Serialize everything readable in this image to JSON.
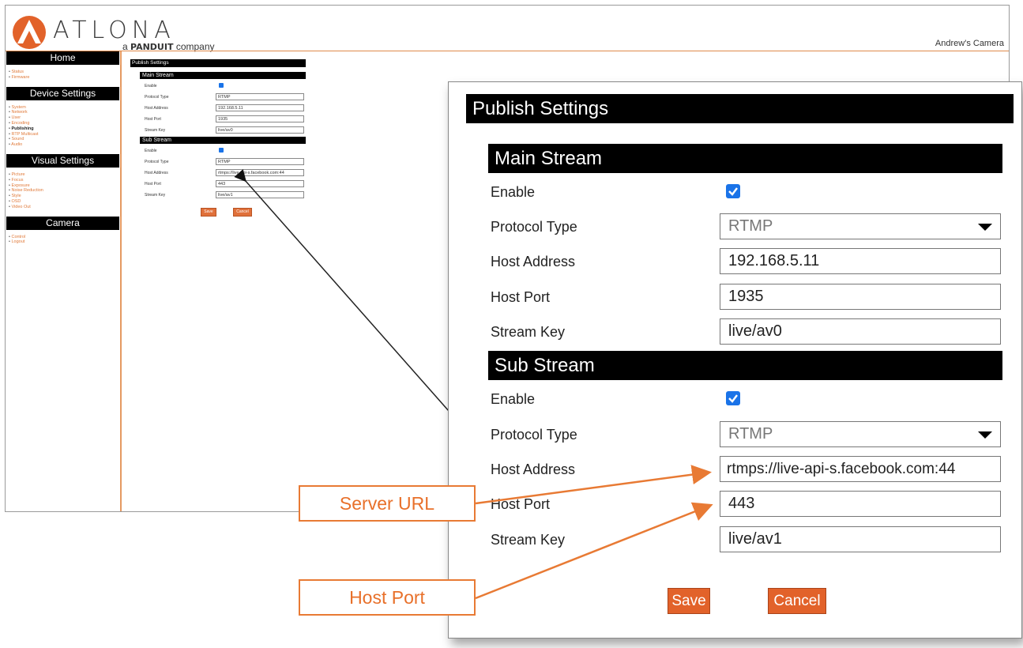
{
  "brand": {
    "logo_text": "ATLONA",
    "tagline_prefix": "a",
    "tagline_brand": "PANDUIT",
    "tagline_suffix": "company",
    "logo_icon": "atlona-logo-icon"
  },
  "camera_name": "Andrew's Camera",
  "sidebar": {
    "sections": [
      {
        "title": "Home",
        "items": [
          "Status",
          "Firmware"
        ]
      },
      {
        "title": "Device Settings",
        "items": [
          "System",
          "Network",
          "User",
          "Encoding",
          "Publishing",
          "RTP Multicast",
          "Sound",
          "Audio"
        ],
        "active": "Publishing"
      },
      {
        "title": "Visual Settings",
        "items": [
          "Picture",
          "Focus",
          "Exposure",
          "Noise Reduction",
          "Style",
          "OSD",
          "Video Out"
        ]
      },
      {
        "title": "Camera",
        "items": [
          "Control",
          "Logout"
        ]
      }
    ]
  },
  "mini_form": {
    "title": "Publish Settings",
    "main_title": "Main Stream",
    "sub_title": "Sub Stream",
    "labels": {
      "enable": "Enable",
      "protocol": "Protocol Type",
      "host": "Host Address",
      "port": "Host Port",
      "key": "Stream Key"
    },
    "main": {
      "protocol": "RTMP",
      "host": "192.168.5.11",
      "port": "1935",
      "key": "live/av0"
    },
    "sub": {
      "protocol": "RTMP",
      "host": "rtmps://live-api-s.facebook.com:44",
      "port": "443",
      "key": "live/av1"
    },
    "save": "Save",
    "cancel": "Cancel"
  },
  "publish": {
    "title": "Publish Settings",
    "labels": {
      "enable": "Enable",
      "protocol": "Protocol Type",
      "host": "Host Address",
      "port": "Host Port",
      "key": "Stream Key"
    },
    "main": {
      "title": "Main Stream",
      "enabled": true,
      "protocol": "RTMP",
      "host": "192.168.5.11",
      "port": "1935",
      "key": "live/av0"
    },
    "sub": {
      "title": "Sub Stream",
      "enabled": true,
      "protocol": "RTMP",
      "host": "rtmps://live-api-s.facebook.com:44",
      "port": "443",
      "key": "live/av1"
    },
    "save": "Save",
    "cancel": "Cancel"
  },
  "callouts": {
    "server_url": "Server URL",
    "host_port": "Host Port"
  },
  "colors": {
    "accent": "#e2622a",
    "callout": "#e87a34",
    "checkbox": "#1a73e8"
  }
}
